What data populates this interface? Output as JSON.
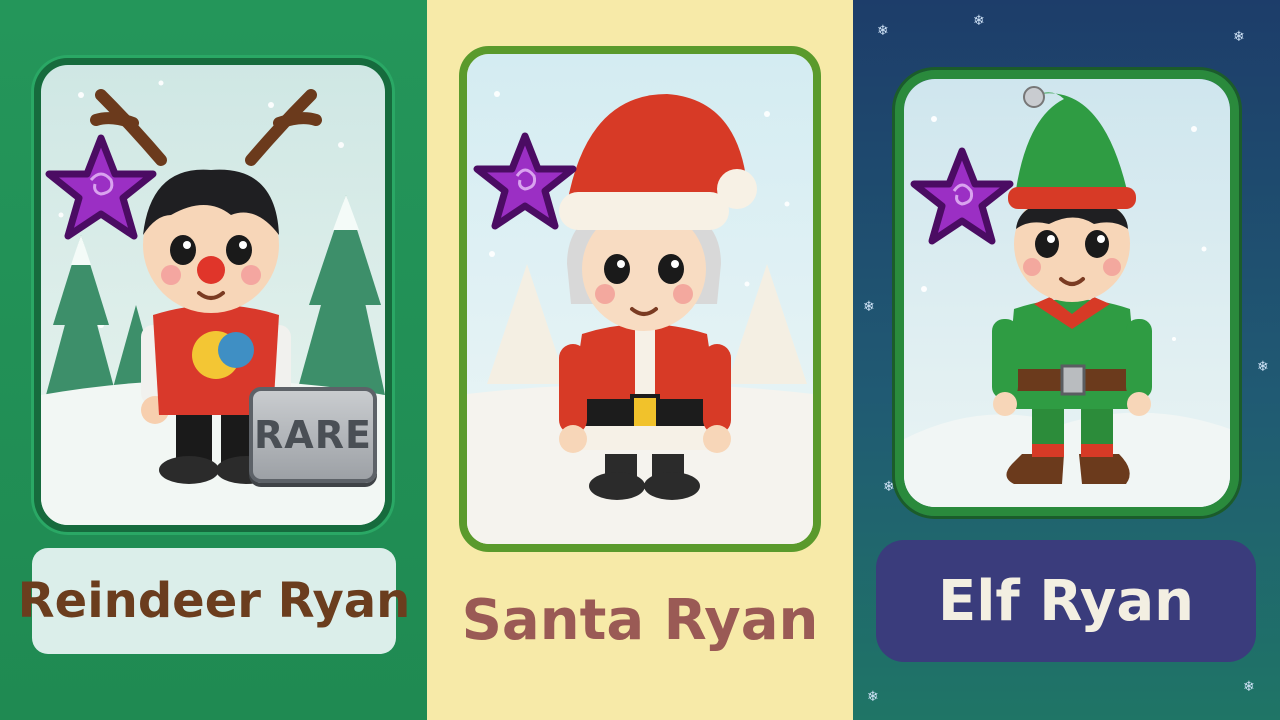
{
  "cards": [
    {
      "name": "Reindeer Ryan",
      "badge": "RARE"
    },
    {
      "name": "Santa Ryan"
    },
    {
      "name": "Elf Ryan"
    }
  ],
  "colors": {
    "panel_green": "#24965a",
    "panel_cream": "#f7eaa8",
    "panel_night": "#1d3d6a",
    "star_purple": "#9b2fc4"
  },
  "icons": [
    "purple-star-icon",
    "snowflake-icon"
  ]
}
